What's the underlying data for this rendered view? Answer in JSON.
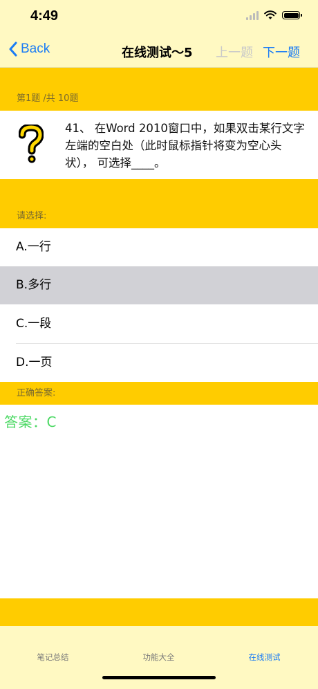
{
  "status": {
    "time": "4:49"
  },
  "nav": {
    "back_label": "Back",
    "title": "在线测试～5",
    "prev_label": "上一题",
    "next_label": "下一题"
  },
  "question": {
    "progress": "第1题 /共 10题",
    "text": "41、 在Word 2010窗口中，如果双击某行文字左端的空白处（此时鼠标指针将变为空心头状）， 可选择____。"
  },
  "choice_header": "请选择:",
  "options": [
    {
      "label": "A.一行",
      "selected": false
    },
    {
      "label": "B.多行",
      "selected": true
    },
    {
      "label": "C.一段",
      "selected": false
    },
    {
      "label": "D.一页",
      "selected": false
    }
  ],
  "answer": {
    "header": "正确答案:",
    "text": "答案：C"
  },
  "tabs": [
    {
      "label": "笔记总结",
      "active": false
    },
    {
      "label": "功能大全",
      "active": false
    },
    {
      "label": "在线测试",
      "active": true
    }
  ],
  "colors": {
    "accent": "#1a7cf5",
    "header_yellow": "#ffcc00",
    "bar_bg": "#fff9c2",
    "answer_green": "#4cd964",
    "selected_gray": "#d1d1d6"
  }
}
